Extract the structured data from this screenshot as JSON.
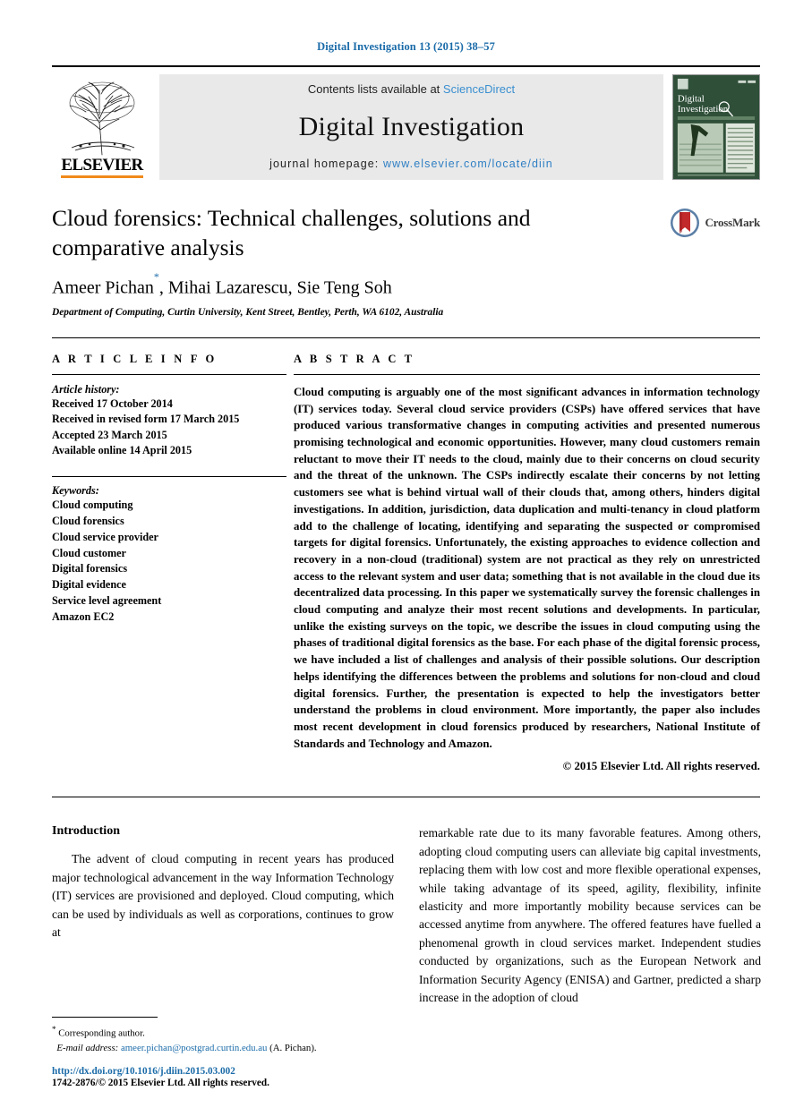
{
  "running_head": "Digital Investigation 13 (2015) 38–57",
  "masthead": {
    "publisher_name": "ELSEVIER",
    "contents_prefix": "Contents lists available at",
    "sciencedirect": "ScienceDirect",
    "journal_title": "Digital Investigation",
    "homepage_label": "journal homepage:",
    "homepage_url": "www.elsevier.com/locate/diin",
    "cover_title_line1": "Digital",
    "cover_title_line2": "Investigation"
  },
  "title_block": {
    "title": "Cloud forensics: Technical challenges, solutions and comparative analysis",
    "authors": "Ameer Pichan",
    "authors_rest": ", Mihai Lazarescu, Sie Teng Soh",
    "corresponding_marker": "*",
    "affiliation": "Department of Computing, Curtin University, Kent Street, Bentley, Perth, WA 6102, Australia",
    "crossmark_label": "CrossMark"
  },
  "article_info": {
    "heading": "A R T I C L E   I N F O",
    "history_label": "Article history:",
    "history": [
      "Received 17 October 2014",
      "Received in revised form 17 March 2015",
      "Accepted 23 March 2015",
      "Available online 14 April 2015"
    ],
    "keywords_label": "Keywords:",
    "keywords": [
      "Cloud computing",
      "Cloud forensics",
      "Cloud service provider",
      "Cloud customer",
      "Digital forensics",
      "Digital evidence",
      "Service level agreement",
      "Amazon EC2"
    ]
  },
  "abstract": {
    "heading": "A B S T R A C T",
    "text": "Cloud computing is arguably one of the most significant advances in information technology (IT) services today. Several cloud service providers (CSPs) have offered services that have produced various transformative changes in computing activities and presented numerous promising technological and economic opportunities. However, many cloud customers remain reluctant to move their IT needs to the cloud, mainly due to their concerns on cloud security and the threat of the unknown. The CSPs indirectly escalate their concerns by not letting customers see what is behind virtual wall of their clouds that, among others, hinders digital investigations. In addition, jurisdiction, data duplication and multi-tenancy in cloud platform add to the challenge of locating, identifying and separating the suspected or compromised targets for digital forensics. Unfortunately, the existing approaches to evidence collection and recovery in a non-cloud (traditional) system are not practical as they rely on unrestricted access to the relevant system and user data; something that is not available in the cloud due its decentralized data processing. In this paper we systematically survey the forensic challenges in cloud computing and analyze their most recent solutions and developments. In particular, unlike the existing surveys on the topic, we describe the issues in cloud computing using the phases of traditional digital forensics as the base. For each phase of the digital forensic process, we have included a list of challenges and analysis of their possible solutions. Our description helps identifying the differences between the problems and solutions for non-cloud and cloud digital forensics. Further, the presentation is expected to help the investigators better understand the problems in cloud environment. More importantly, the paper also includes most recent development in cloud forensics produced by researchers, National Institute of Standards and Technology and Amazon.",
    "copyright": "© 2015 Elsevier Ltd. All rights reserved."
  },
  "body": {
    "section_heading": "Introduction",
    "left_paragraph": "The advent of cloud computing in recent years has produced major technological advancement in the way Information Technology (IT) services are provisioned and deployed. Cloud computing, which can be used by individuals as well as corporations, continues to grow at",
    "right_paragraph": "remarkable rate due to its many favorable features. Among others, adopting cloud computing users can alleviate big capital investments, replacing them with low cost and more flexible operational expenses, while taking advantage of its speed, agility, flexibility, infinite elasticity and more importantly mobility because services can be accessed anytime from anywhere. The offered features have fuelled a phenomenal growth in cloud services market. Independent studies conducted by organizations, such as the European Network and Information Security Agency (ENISA) and Gartner, predicted a sharp increase in the adoption of cloud"
  },
  "footnotes": {
    "corresponding_marker": "*",
    "corresponding_text": "Corresponding author.",
    "email_label": "E-mail address:",
    "email": "ameer.pichan@postgrad.curtin.edu.au",
    "email_suffix": "(A. Pichan).",
    "doi": "http://dx.doi.org/10.1016/j.diin.2015.03.002",
    "issn": "1742-2876/© 2015 Elsevier Ltd. All rights reserved."
  },
  "colors": {
    "link_blue": "#1a6ba8",
    "sciencedirect_blue": "#3a8fd0",
    "elsevier_orange": "#f08a1b",
    "cover_green": "#2f4f39",
    "crossmark_red": "#c1292b"
  }
}
